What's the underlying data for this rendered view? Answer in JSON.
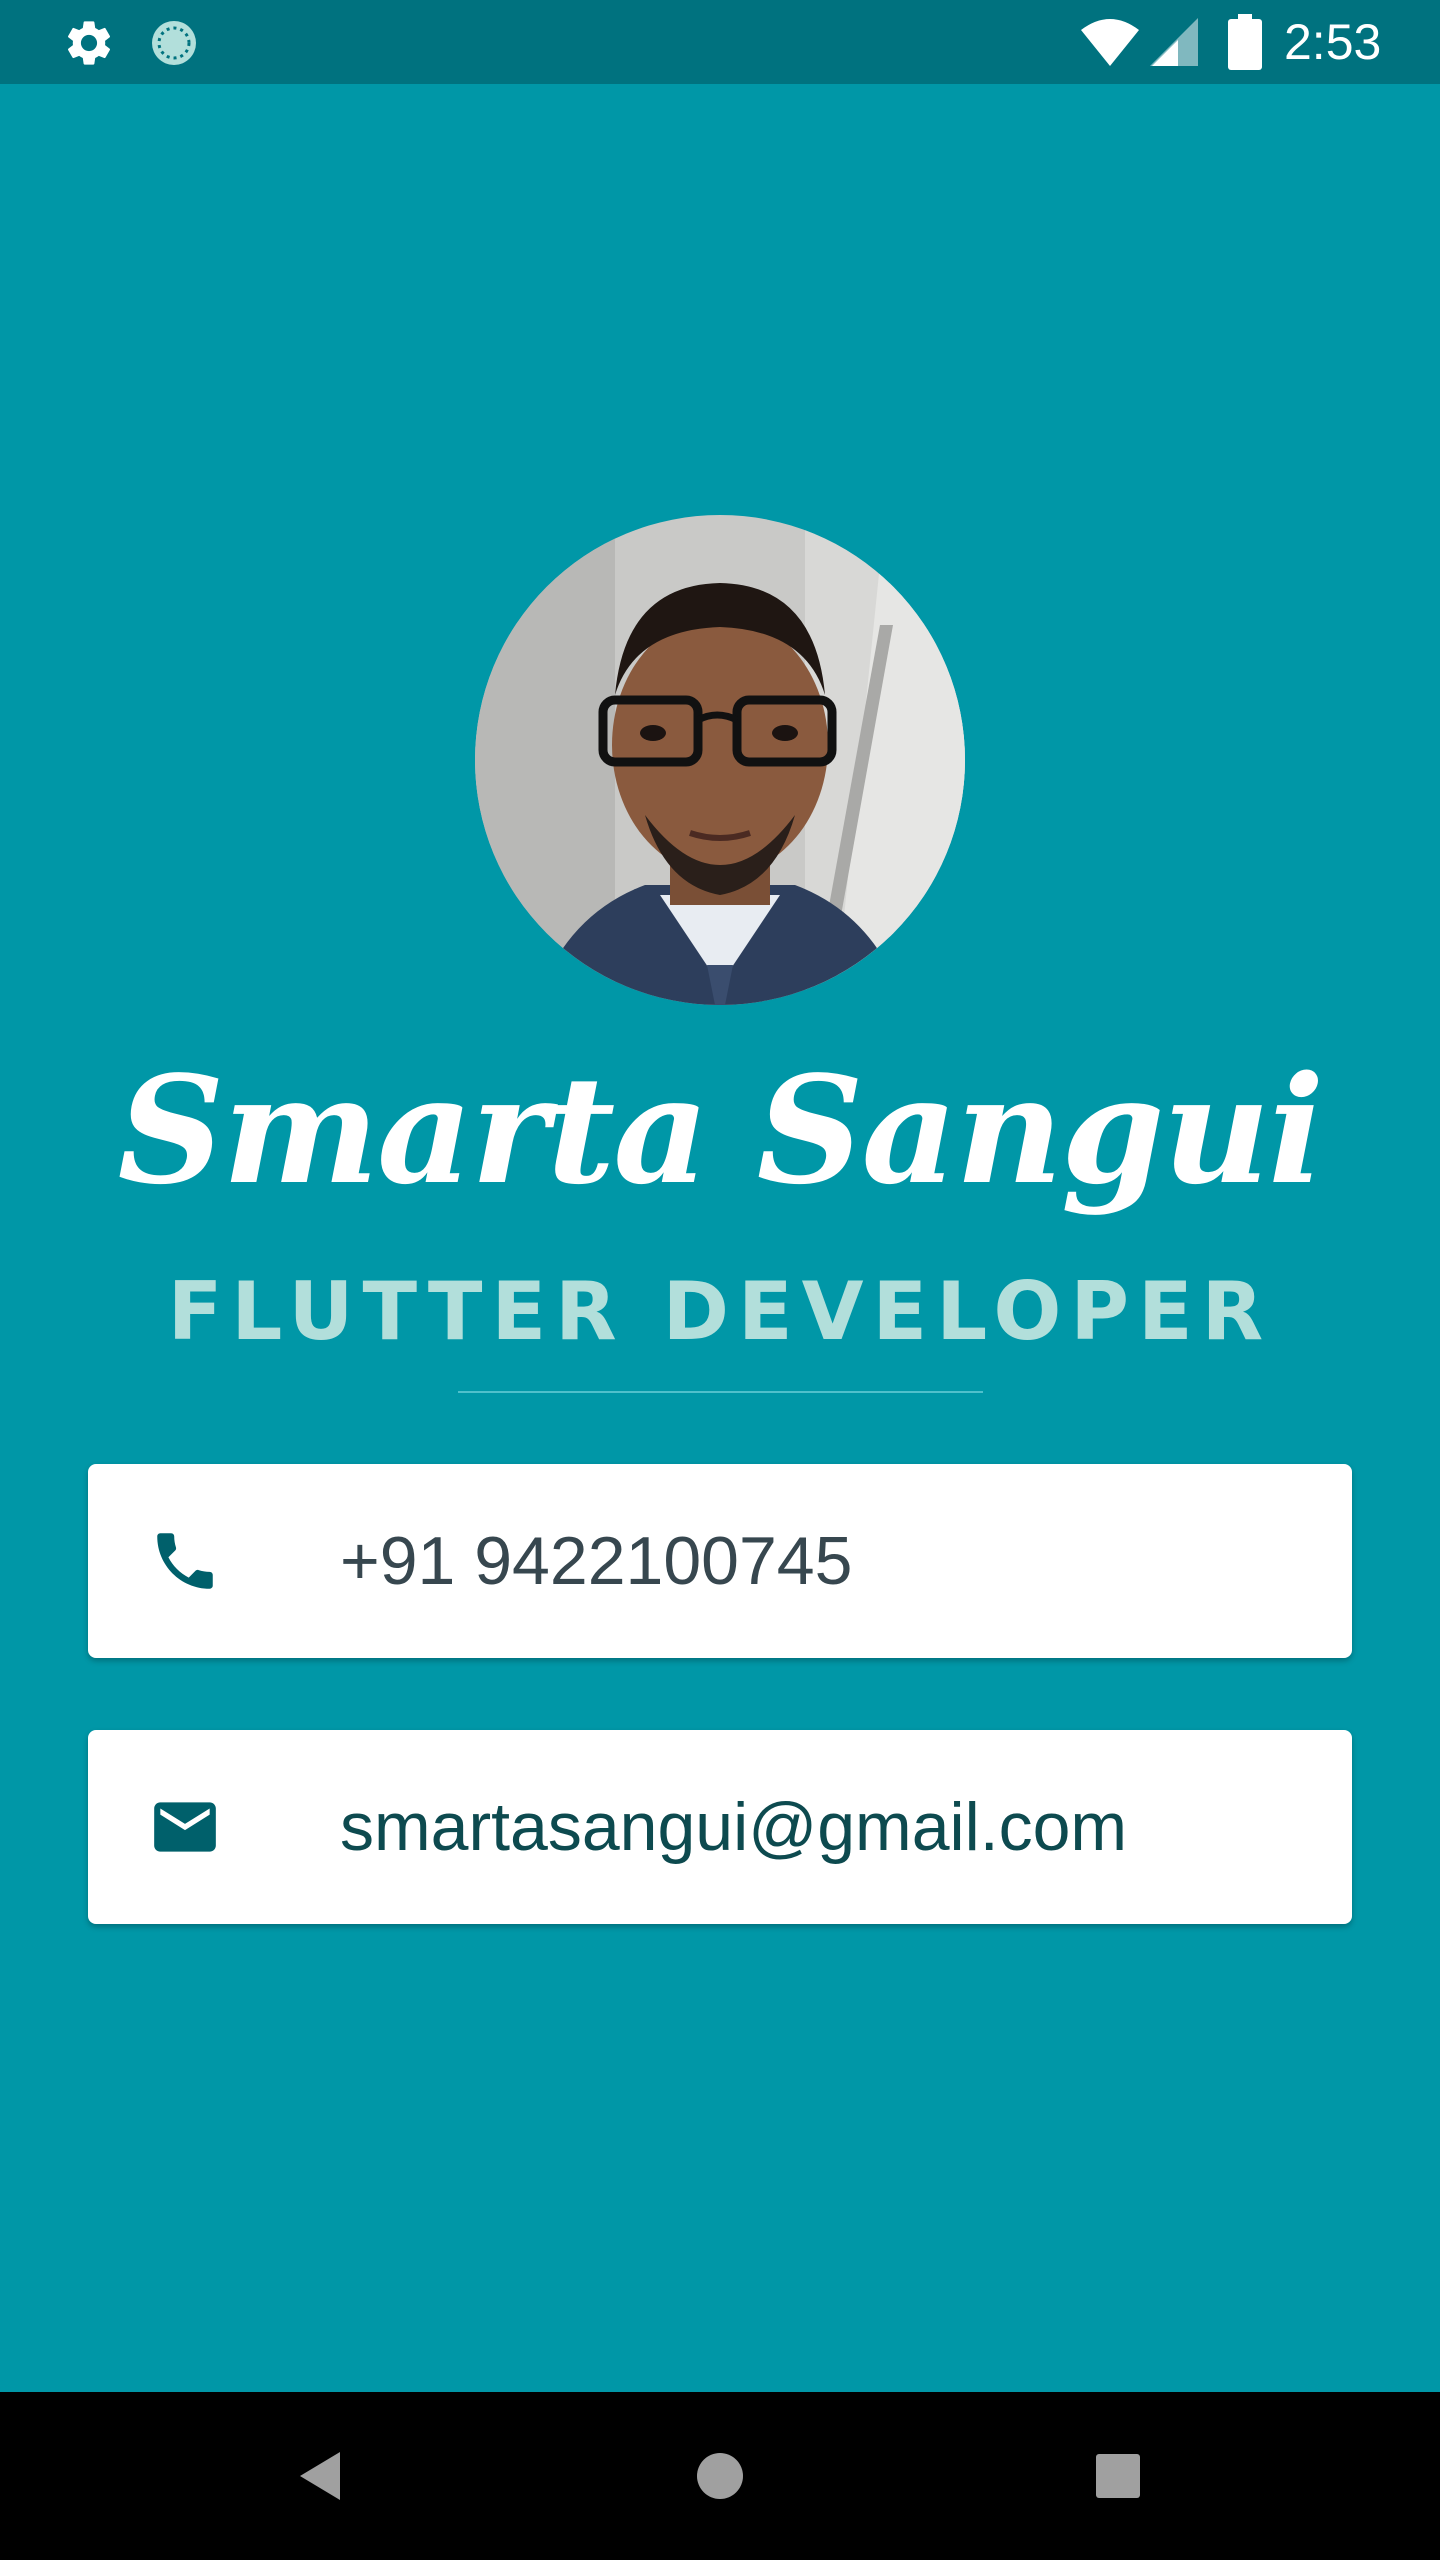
{
  "status_bar": {
    "time": "2:53",
    "icons": [
      "gear-icon",
      "sync-icon",
      "wifi-icon",
      "signal-icon",
      "battery-icon"
    ]
  },
  "profile": {
    "avatar": "avatar-photo",
    "name": "Smarta Sangui",
    "title": "FLUTTER DEVELOPER"
  },
  "contacts": {
    "phone": {
      "icon": "phone-icon",
      "value": "+91 9422100745"
    },
    "email": {
      "icon": "mail-icon",
      "value": "smartasangui@gmail.com"
    }
  },
  "nav_bar": {
    "buttons": [
      "back-icon",
      "home-icon",
      "recents-icon"
    ]
  },
  "colors": {
    "background": "#0097a7",
    "status_bar": "#00727f",
    "title_text": "#b2dfdb",
    "icon_teal": "#00606b",
    "card": "#ffffff"
  }
}
